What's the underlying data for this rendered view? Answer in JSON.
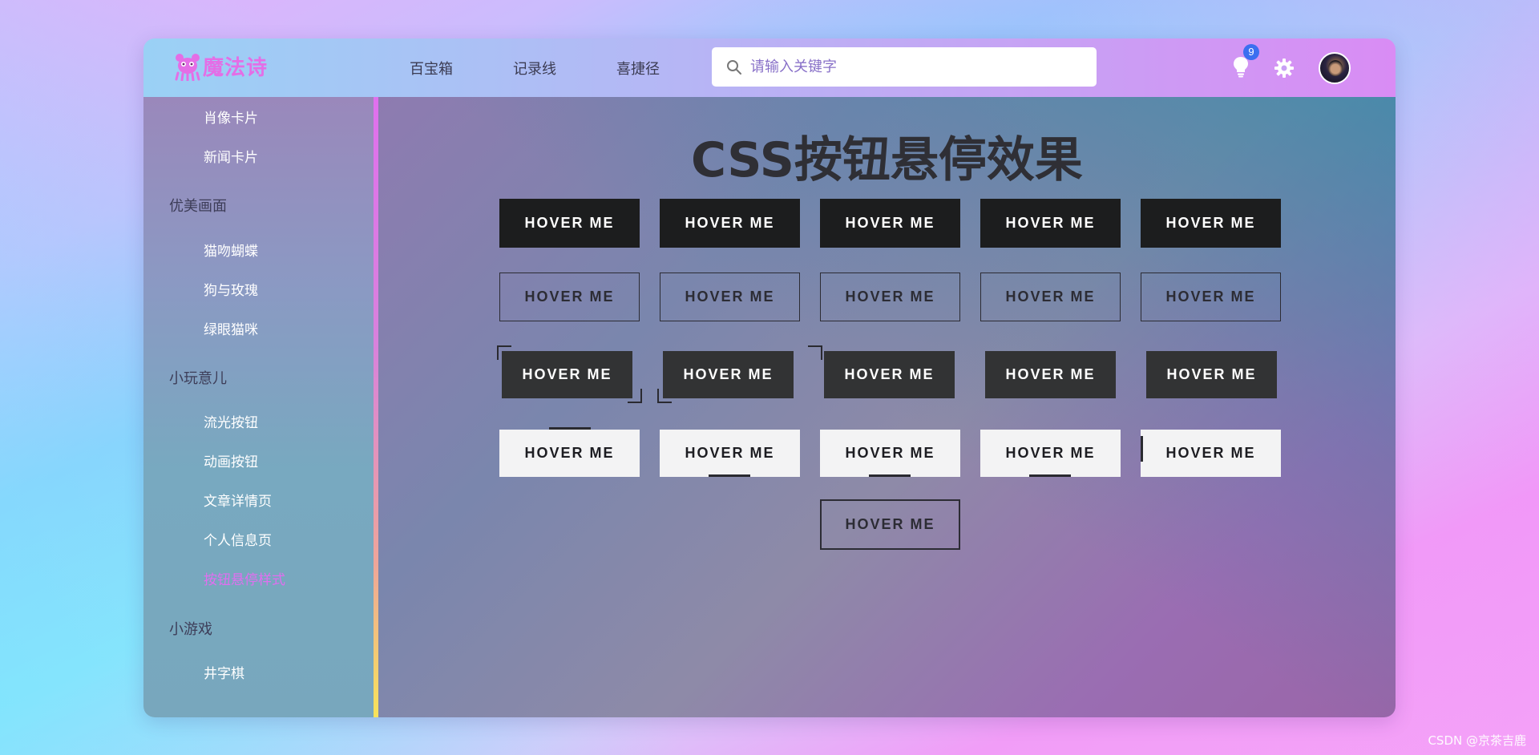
{
  "app": {
    "logo_text": "魔法诗",
    "nav": [
      "百宝箱",
      "记录线",
      "喜捷径"
    ],
    "search": {
      "placeholder": "请输入关键字",
      "value": ""
    },
    "notifications_count": "9"
  },
  "sidebar": {
    "items": [
      {
        "type": "item",
        "label": "肖像卡片"
      },
      {
        "type": "item",
        "label": "新闻卡片"
      },
      {
        "type": "group",
        "label": "优美画面"
      },
      {
        "type": "item",
        "label": "猫吻蝴蝶"
      },
      {
        "type": "item",
        "label": "狗与玫瑰"
      },
      {
        "type": "item",
        "label": "绿眼猫咪"
      },
      {
        "type": "group",
        "label": "小玩意儿"
      },
      {
        "type": "item",
        "label": "流光按钮"
      },
      {
        "type": "item",
        "label": "动画按钮"
      },
      {
        "type": "item",
        "label": "文章详情页"
      },
      {
        "type": "item",
        "label": "个人信息页"
      },
      {
        "type": "item",
        "label": "按钮悬停样式",
        "active": true
      },
      {
        "type": "group",
        "label": "小游戏"
      },
      {
        "type": "item",
        "label": "井字棋"
      }
    ]
  },
  "main": {
    "title": "CSS按钮悬停效果",
    "button_label": "HOVER ME"
  },
  "colors": {
    "accent": "#e16ef0",
    "badge": "#3b6ff0",
    "dark_button": "#1c1d1e"
  },
  "watermark": "CSDN @京茶吉鹿"
}
